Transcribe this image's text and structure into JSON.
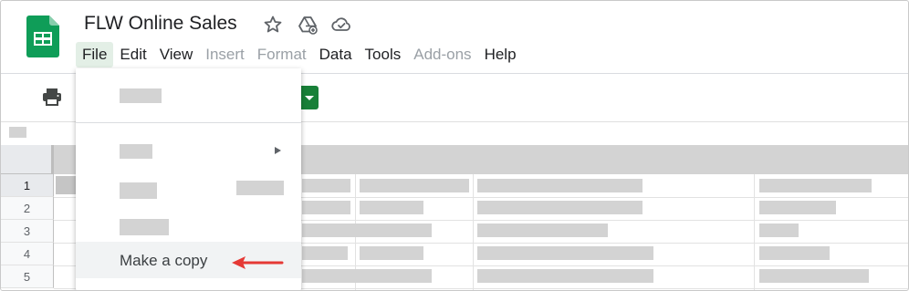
{
  "app": {
    "doc_title": "FLW Online Sales",
    "logo_icon": "google-sheets-icon",
    "title_icons": [
      "star-icon",
      "move-to-drive-icon",
      "cloud-saved-icon"
    ]
  },
  "menubar": {
    "items": [
      {
        "label": "File",
        "state": "active"
      },
      {
        "label": "Edit",
        "state": "enabled"
      },
      {
        "label": "View",
        "state": "enabled"
      },
      {
        "label": "Insert",
        "state": "disabled"
      },
      {
        "label": "Format",
        "state": "disabled"
      },
      {
        "label": "Data",
        "state": "enabled"
      },
      {
        "label": "Tools",
        "state": "enabled"
      },
      {
        "label": "Add-ons",
        "state": "disabled"
      },
      {
        "label": "Help",
        "state": "enabled"
      }
    ]
  },
  "toolbar": {
    "print_icon": "print-icon",
    "accent_color": "#188038"
  },
  "grid": {
    "row_numbers": [
      "1",
      "2",
      "3",
      "4",
      "5"
    ],
    "selected_row": "1"
  },
  "file_menu": {
    "highlighted_item": "Make a copy",
    "submenu_arrow_icon": "submenu-arrow-icon",
    "pointer_icon": "red-arrow-icon",
    "pointer_color": "#e53935"
  }
}
